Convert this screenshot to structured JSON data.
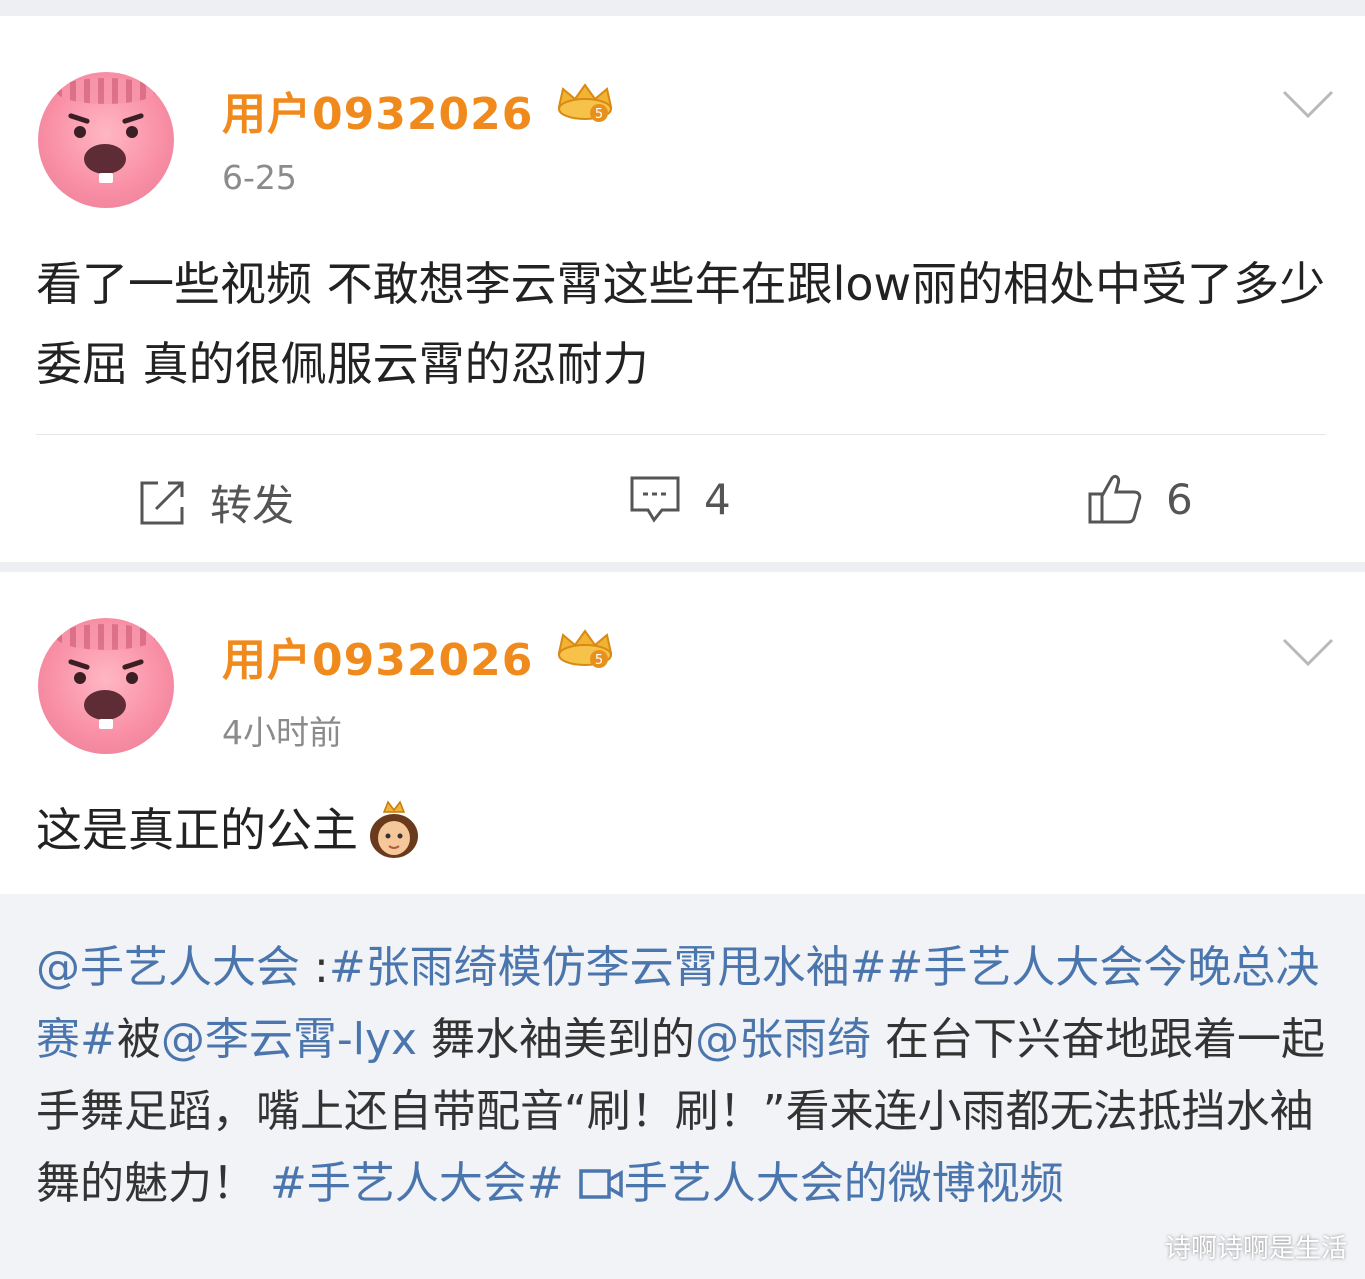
{
  "posts": [
    {
      "username": "用户0932026",
      "time": "6-25",
      "text": "看了一些视频 不敢想李云霄这些年在跟low丽的相处中受了多少委屈 真的很佩服云霄的忍耐力",
      "actions": {
        "repost_label": "转发",
        "comment_count": "4",
        "like_count": "6"
      }
    },
    {
      "username": "用户0932026",
      "time": "4小时前",
      "text": "这是真正的公主",
      "repost": {
        "mention_author": "@手艺人大会",
        "sep": " :",
        "tag1": "#张雨绮模仿李云霄甩水袖#",
        "tag2": "#手艺人大会今晚总决赛#",
        "t1": "被",
        "mention2": "@李云霄-lyx",
        "t2": " 舞水袖美到的",
        "mention3": "@张雨绮",
        "t3": " 在台下兴奋地跟着一起手舞足蹈，嘴上还自带配音“刷！刷！”看来连小雨都无法抵挡水袖舞的魅力！",
        "tag3": "#手艺人大会#",
        "video_link": "手艺人大会的微博视频"
      }
    }
  ],
  "watermark": "诗啊诗啊是生活",
  "colors": {
    "username": "#f08a1c",
    "link": "#4a76ad",
    "page_bg": "#eeeff2"
  },
  "icons": [
    "crown-badge-icon",
    "chevron-down-icon",
    "repost-icon",
    "comment-icon",
    "thumbs-up-icon",
    "princess-emoji-icon",
    "video-camera-icon"
  ]
}
